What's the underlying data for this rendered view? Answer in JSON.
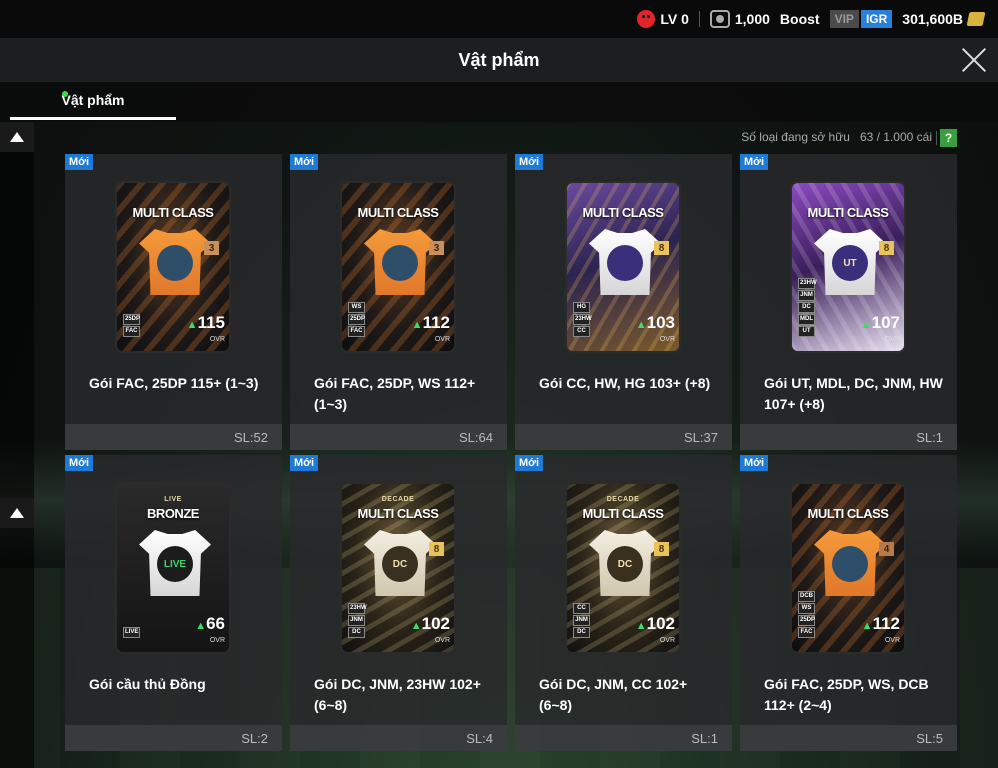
{
  "status": {
    "level": "LV 0",
    "coins": "1,000",
    "boost": "Boost",
    "vip": "VIP",
    "igr": "IGR",
    "bp": "301,600B"
  },
  "header": {
    "title": "Vật phẩm"
  },
  "tabs": [
    {
      "label": "Vật phẩm",
      "active": true
    }
  ],
  "owned": {
    "label": "Số loại đang sở hữu",
    "count": "63 / 1.000 cái",
    "help": "?"
  },
  "items": [
    {
      "badge": "Mới",
      "pack_title": "MULTI CLASS",
      "pack_sub": "",
      "level": "3",
      "ovr": "115",
      "ovr_label": "OVR",
      "tags": [
        "25DP",
        "FAC"
      ],
      "name": "Gói FAC, 25DP 115+ (1~3)",
      "qty": "SL:52",
      "theme": "dark",
      "jersey": "orange",
      "lvtone": "bronze",
      "emblem": ""
    },
    {
      "badge": "Mới",
      "pack_title": "MULTI CLASS",
      "pack_sub": "",
      "level": "3",
      "ovr": "112",
      "ovr_label": "OVR",
      "tags": [
        "WS",
        "25DP",
        "FAC"
      ],
      "name": "Gói FAC, 25DP, WS 112+ (1~3)",
      "qty": "SL:64",
      "theme": "dark",
      "jersey": "orange",
      "lvtone": "bronze",
      "emblem": ""
    },
    {
      "badge": "Mới",
      "pack_title": "MULTI CLASS",
      "pack_sub": "",
      "level": "8",
      "ovr": "103",
      "ovr_label": "OVR",
      "tags": [
        "HG",
        "23HW",
        "CC"
      ],
      "name": "Gói CC, HW, HG 103+ (+8)",
      "qty": "SL:37",
      "theme": "purple",
      "jersey": "white",
      "lvtone": "gold",
      "emblem": ""
    },
    {
      "badge": "Mới",
      "pack_title": "MULTI CLASS",
      "pack_sub": "",
      "level": "8",
      "ovr": "107",
      "ovr_label": "OVR",
      "tags": [
        "23HW",
        "JNM",
        "DC",
        "MDL",
        "UT"
      ],
      "name": "Gói UT, MDL, DC, JNM, HW 107+ (+8)",
      "qty": "SL:1",
      "theme": "violet",
      "jersey": "white",
      "lvtone": "gold",
      "emblem": "UT"
    },
    {
      "badge": "Mới",
      "pack_title": "BRONZE",
      "pack_sub": "LIVE",
      "level": "",
      "ovr": "66",
      "ovr_label": "OVR",
      "tags": [
        "LIVE"
      ],
      "name": "Gói cầu thủ Đồng",
      "qty": "SL:2",
      "theme": "bronze",
      "jersey": "white",
      "lvtone": "",
      "emblem": "LIVE"
    },
    {
      "badge": "Mới",
      "pack_title": "MULTI CLASS",
      "pack_sub": "DECADE",
      "level": "8",
      "ovr": "102",
      "ovr_label": "OVR",
      "tags": [
        "23HW",
        "JNM",
        "DC"
      ],
      "name": "Gói DC, JNM, 23HW 102+ (6~8)",
      "qty": "SL:4",
      "theme": "decade",
      "jersey": "cream",
      "lvtone": "gold",
      "emblem": "DC"
    },
    {
      "badge": "Mới",
      "pack_title": "MULTI CLASS",
      "pack_sub": "DECADE",
      "level": "8",
      "ovr": "102",
      "ovr_label": "OVR",
      "tags": [
        "CC",
        "JNM",
        "DC"
      ],
      "name": "Gói DC, JNM, CC 102+ (6~8)",
      "qty": "SL:1",
      "theme": "decade",
      "jersey": "cream",
      "lvtone": "gold",
      "emblem": "DC"
    },
    {
      "badge": "Mới",
      "pack_title": "MULTI CLASS",
      "pack_sub": "",
      "level": "4",
      "ovr": "112",
      "ovr_label": "OVR",
      "tags": [
        "DCB",
        "WS",
        "25DP",
        "FAC"
      ],
      "name": "Gói FAC, 25DP, WS, DCB 112+ (2~4)",
      "qty": "SL:5",
      "theme": "dark",
      "jersey": "orange",
      "lvtone": "brown",
      "emblem": ""
    }
  ]
}
